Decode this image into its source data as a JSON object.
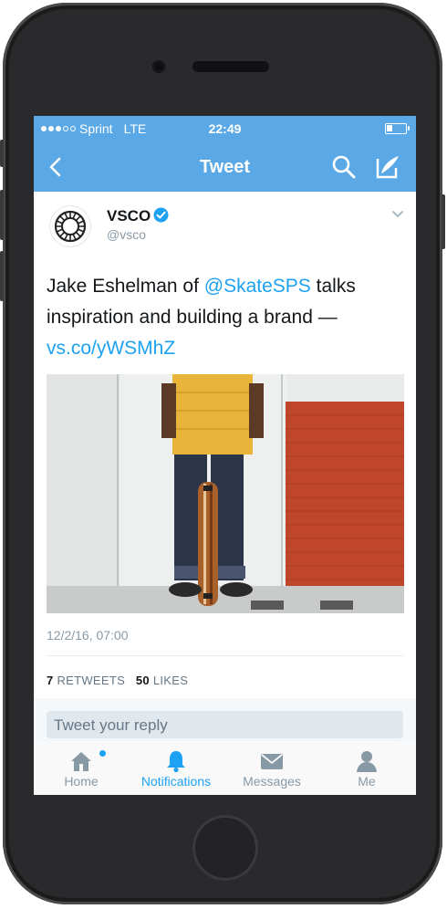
{
  "status_bar": {
    "carrier": "Sprint",
    "network": "LTE",
    "time": "22:49"
  },
  "nav": {
    "title": "Tweet",
    "icons": [
      "back-chevron-icon",
      "search-icon",
      "compose-icon"
    ]
  },
  "tweet": {
    "name": "VSCO",
    "handle": "@vsco",
    "text_part1": "Jake Eshelman of ",
    "mention": "@SkateSPS",
    "text_part2": " talks inspiration and building a brand —",
    "link": "vs.co/yWSMhZ",
    "timestamp": "12/2/16, 07:00",
    "retweets_count": "7",
    "retweets_label": "RETWEETS",
    "likes_count": "50",
    "likes_label": "LIKES"
  },
  "reply": {
    "placeholder": "Tweet your reply"
  },
  "tabs": [
    {
      "label": "Home",
      "icon": "home-icon"
    },
    {
      "label": "Notifications",
      "icon": "bell-icon",
      "active": true
    },
    {
      "label": "Messages",
      "icon": "envelope-icon"
    },
    {
      "label": "Me",
      "icon": "person-icon"
    }
  ],
  "colors": {
    "brand_blue": "#5aa9e6",
    "link_blue": "#1da1f2",
    "verified_blue": "#1da1f2"
  }
}
